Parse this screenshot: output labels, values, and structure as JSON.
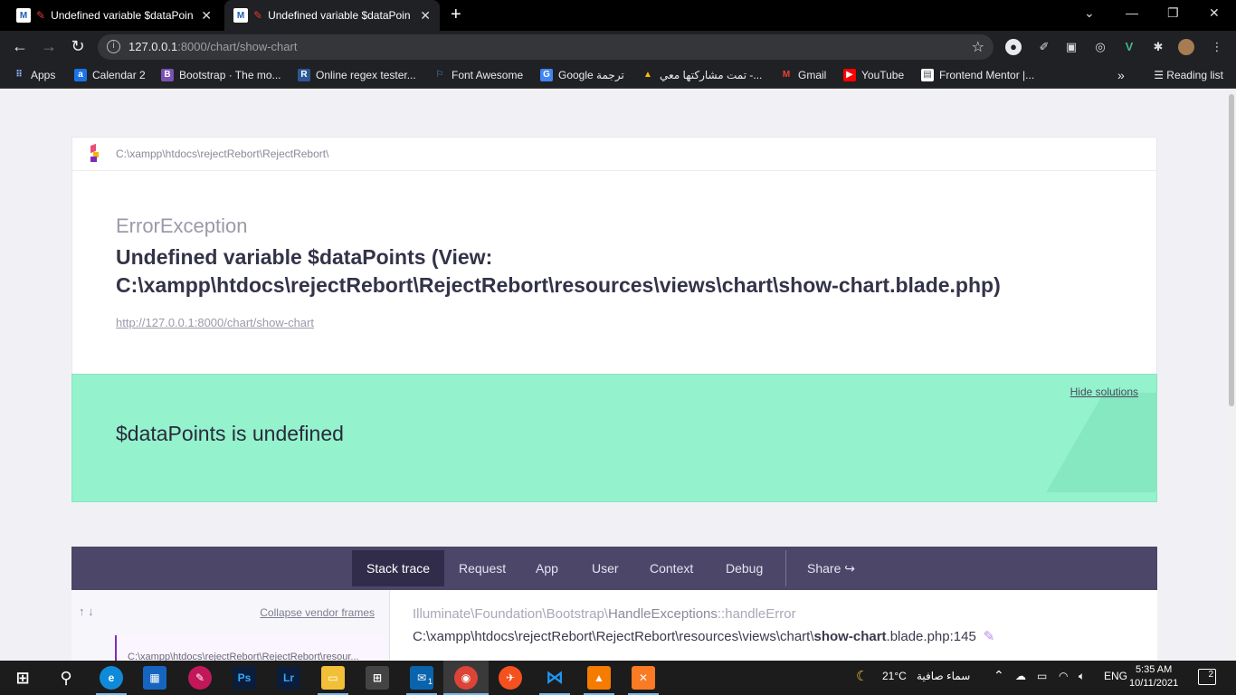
{
  "browser": {
    "tabs": [
      {
        "title": "Undefined variable $dataPoin",
        "active": false
      },
      {
        "title": "Undefined variable $dataPoin",
        "active": true
      }
    ],
    "address": {
      "host": "127.0.0.1",
      "rest": ":8000/chart/show-chart"
    },
    "bookmarks": [
      {
        "label": "Apps",
        "icon": "apps-grid-icon",
        "color": "#e8eaed"
      },
      {
        "label": "Calendar 2",
        "icon": "calendar-icon",
        "color": "#1a73e8"
      },
      {
        "label": "Bootstrap · The mo...",
        "icon": "bootstrap-icon",
        "color": "#7952b3"
      },
      {
        "label": "Online regex tester...",
        "icon": "regex-icon",
        "color": "#2b5797"
      },
      {
        "label": "Font Awesome",
        "icon": "flag-icon",
        "color": "#528dd7"
      },
      {
        "label": "Google ترجمة",
        "icon": "translate-icon",
        "color": "#4285f4"
      },
      {
        "label": "تمت مشاركتها معي -...",
        "icon": "drive-icon",
        "color": "#fbbc04"
      },
      {
        "label": "Gmail",
        "icon": "gmail-icon",
        "color": "#ea4335"
      },
      {
        "label": "YouTube",
        "icon": "youtube-icon",
        "color": "#ff0000"
      },
      {
        "label": "Frontend Mentor |...",
        "icon": "frontend-mentor-icon",
        "color": "#ffffff"
      }
    ],
    "more": "»",
    "reading_list": "Reading list"
  },
  "error": {
    "path": "C:\\xampp\\htdocs\\rejectRebort\\RejectRebort\\",
    "class": "ErrorException",
    "message_line1": "Undefined variable $dataPoints (View:",
    "message_line2": "C:\\xampp\\htdocs\\rejectRebort\\RejectRebort\\resources\\views\\chart\\show-chart.blade.php)",
    "url": "http://127.0.0.1:8000/chart/show-chart"
  },
  "solution": {
    "title": "$dataPoints is undefined",
    "hide_label": "Hide solutions"
  },
  "page_tabs": [
    "Stack trace",
    "Request",
    "App",
    "User",
    "Context",
    "Debug",
    "Share"
  ],
  "stack": {
    "arrows": "↑ ↓",
    "collapse_label": "Collapse vendor frames",
    "frame_preview": "C:\\xampp\\htdocs\\rejectRebort\\RejectRebort\\resour...",
    "class_prefix": "Illuminate\\Foundation\\Bootstrap\\",
    "class_name": "HandleExceptions",
    "method": "::handleError",
    "file_prefix": "C:\\xampp\\htdocs\\rejectRebort\\RejectRebort\\resources\\views\\chart\\",
    "file_name": "show-chart",
    "file_suffix": ".blade.php:145"
  },
  "taskbar": {
    "weather_temp": "21°C",
    "weather_text": "سماء صافية",
    "language": "ENG",
    "time": "5:35 AM",
    "date": "10/11/2021",
    "notifications": "2",
    "mail_badge": "1"
  }
}
